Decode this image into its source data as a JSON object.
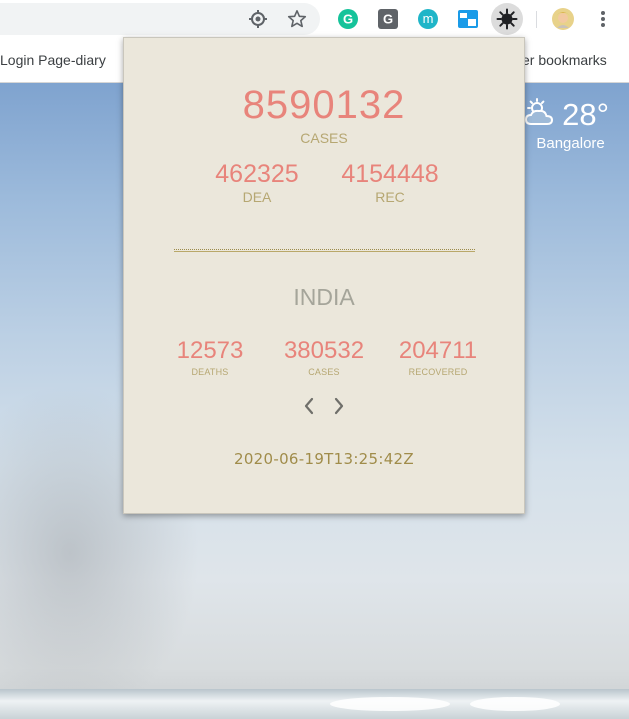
{
  "browser": {
    "bookmarks": {
      "left_item": "Login Page-diary",
      "right_item": "er bookmarks"
    },
    "extension_icons": [
      "grammarly-icon",
      "grammarly-go-icon",
      "mailtrack-icon",
      "window-icon",
      "covid-virus-icon"
    ]
  },
  "new_tab": {
    "weather": {
      "temperature": "28°",
      "city": "Bangalore"
    }
  },
  "popup": {
    "global": {
      "cases": "8590132",
      "cases_label": "CASES",
      "deaths": "462325",
      "deaths_label": "DEA",
      "recovered": "4154448",
      "recovered_label": "REC"
    },
    "country": {
      "name": "INDIA",
      "deaths": "12573",
      "deaths_label": "DEATHS",
      "cases": "380532",
      "cases_label": "CASES",
      "recovered": "204711",
      "recovered_label": "RECOVERED"
    },
    "timestamp": "2020-06-19T13:25:42Z"
  },
  "colors": {
    "popup_bg": "#ebe7db",
    "number": "#e8847b",
    "label": "#b6a772",
    "country": "#a5a59a",
    "timestamp": "#a08c4a"
  }
}
